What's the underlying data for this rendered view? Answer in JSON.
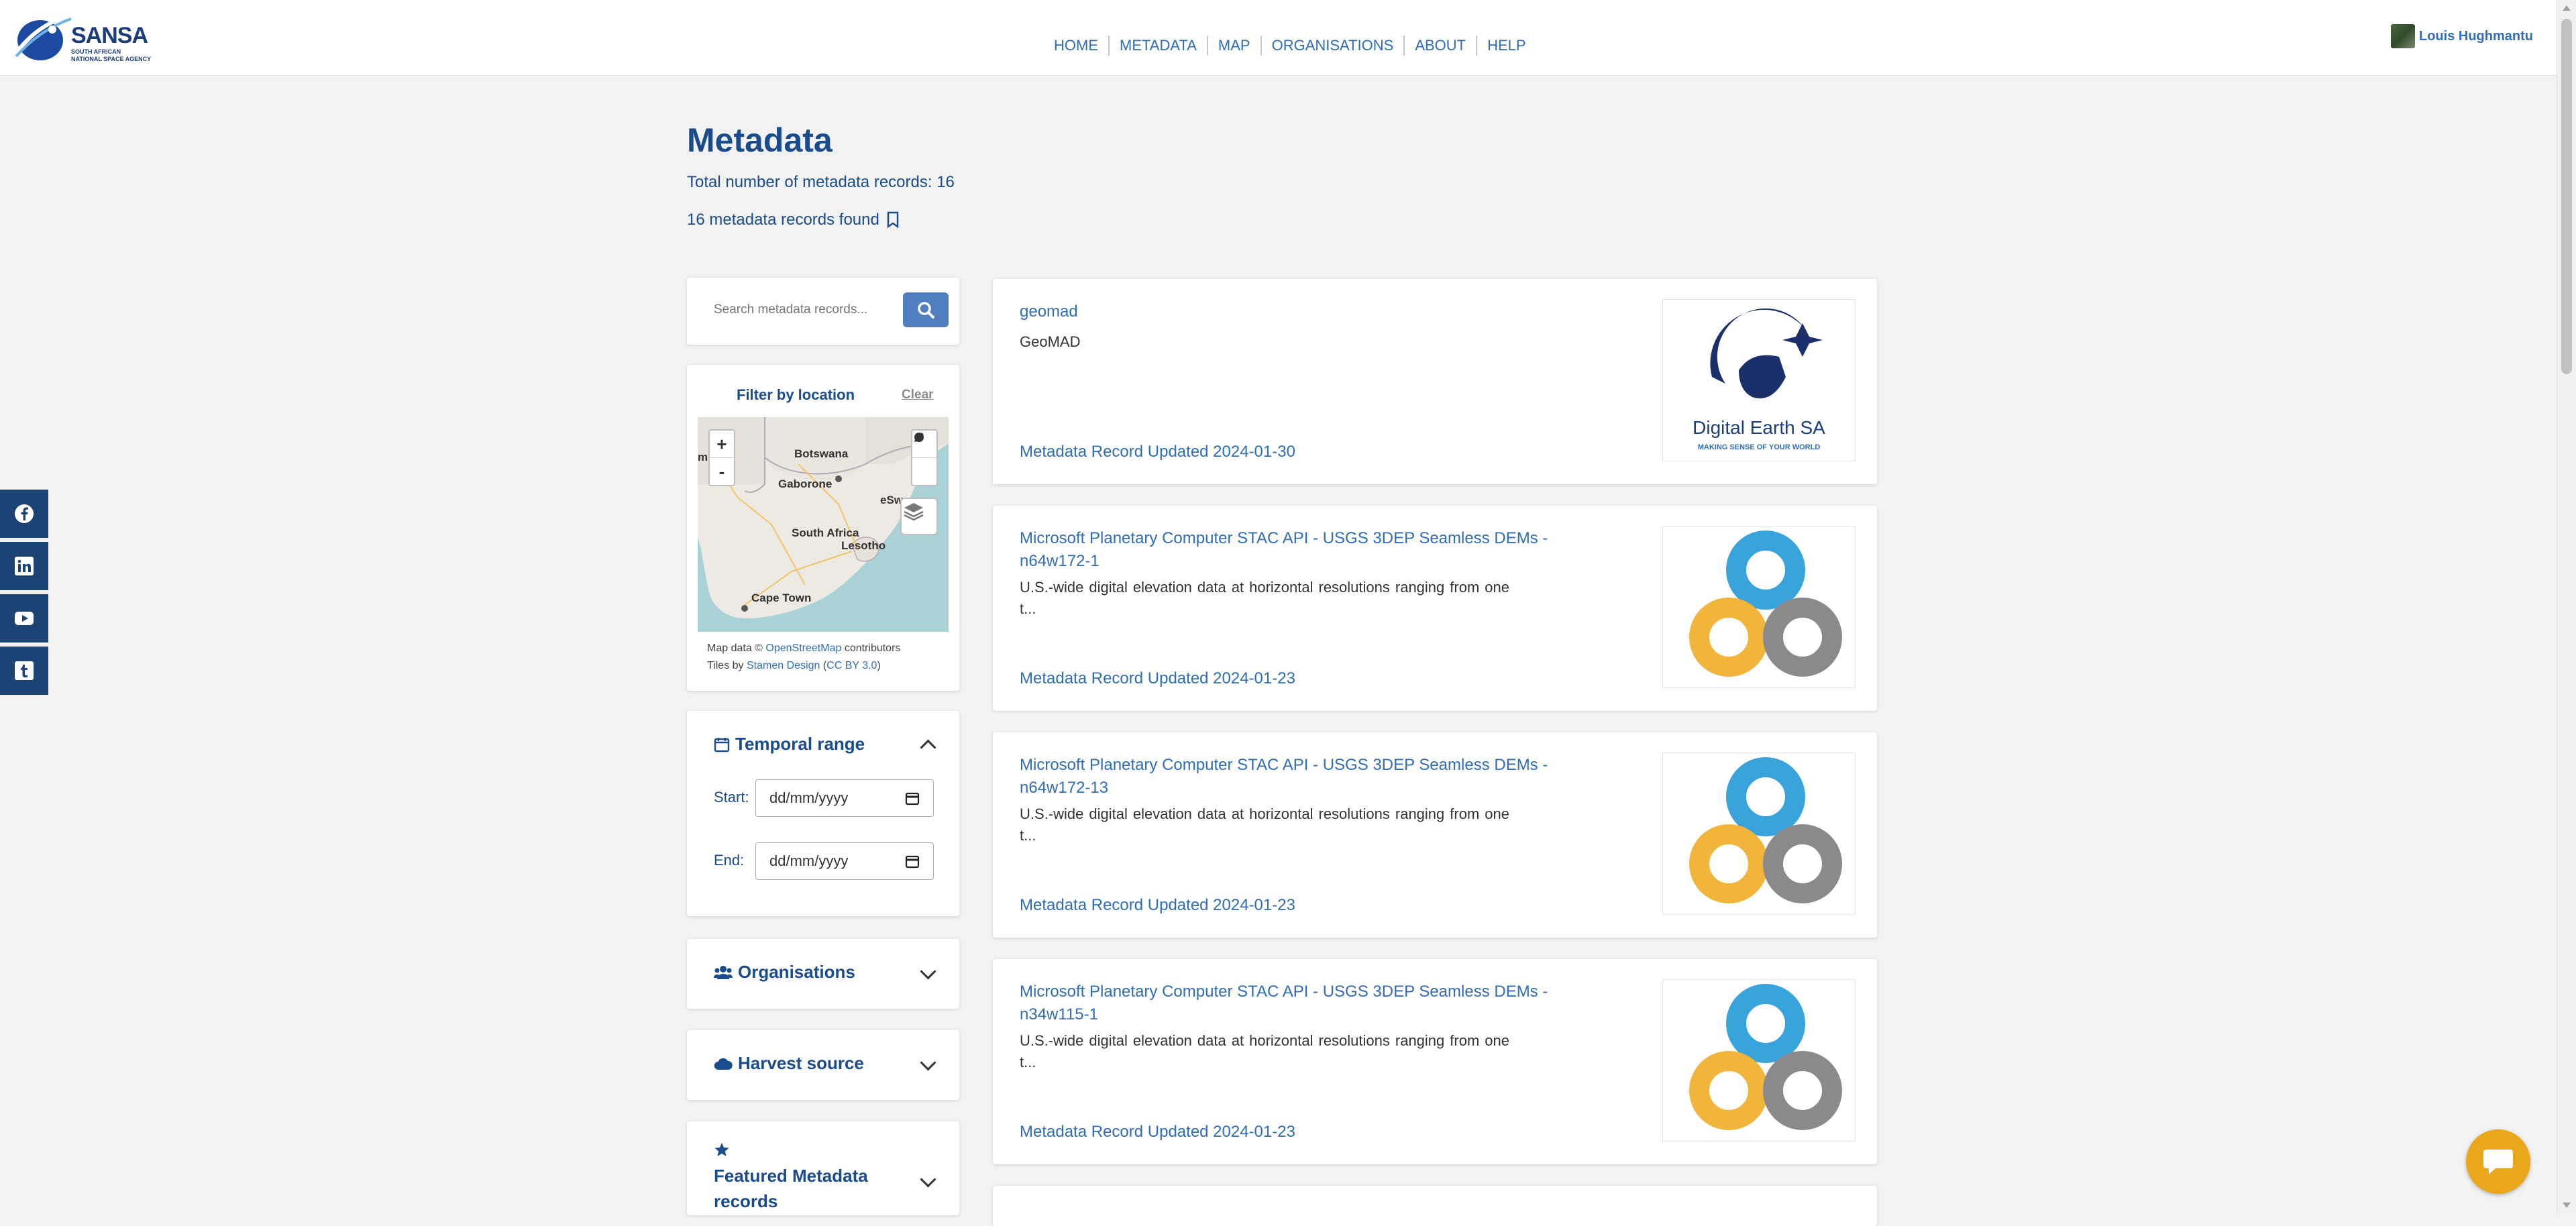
{
  "header": {
    "logo_text": "SANSA",
    "logo_sub": "SOUTH AFRICAN NATIONAL SPACE AGENCY",
    "nav": [
      "HOME",
      "METADATA",
      "MAP",
      "ORGANISATIONS",
      "ABOUT",
      "HELP"
    ],
    "user_name": "Louis Hughmantu"
  },
  "page": {
    "title": "Metadata",
    "total_records": "Total number of metadata records: 16",
    "found": "16 metadata records found"
  },
  "search": {
    "placeholder": "Search metadata records..."
  },
  "location_filter": {
    "title": "Filter by location",
    "clear": "Clear",
    "map_labels": [
      "mibia",
      "Botswana",
      "Gaborone",
      "South Africa",
      "Lesotho",
      "eSw",
      "Cape Town"
    ],
    "zoom_in": "+",
    "zoom_out": "-",
    "attribution_prefix": "Map data ©",
    "attribution_osm": "OpenStreetMap",
    "attribution_contrib": "contributors",
    "tiles_prefix": "Tiles by",
    "tiles_stamen": "Stamen Design",
    "tiles_license": "CC BY 3.0"
  },
  "temporal": {
    "title": "Temporal range",
    "start_label": "Start:",
    "end_label": "End:",
    "date_placeholder": "dd/mm/yyyy"
  },
  "filters": {
    "organisations": "Organisations",
    "harvest_source": "Harvest source",
    "featured": "Featured Metadata records"
  },
  "records": [
    {
      "title": "geomad",
      "description": "GeoMAD",
      "updated": "Metadata Record Updated 2024-01-30",
      "thumb": "digital-earth-sa",
      "thumb_text": "Digital Earth SA",
      "thumb_tagline": "MAKING SENSE OF YOUR WORLD"
    },
    {
      "title": "Microsoft Planetary Computer STAC API - USGS 3DEP Seamless DEMs - n64w172-1",
      "description": "U.S.-wide digital elevation data at horizontal resolutions ranging from one t...",
      "updated": "Metadata Record Updated 2024-01-23",
      "thumb": "planetary-computer"
    },
    {
      "title": "Microsoft Planetary Computer STAC API - USGS 3DEP Seamless DEMs - n64w172-13",
      "description": "U.S.-wide digital elevation data at horizontal resolutions ranging from one t...",
      "updated": "Metadata Record Updated 2024-01-23",
      "thumb": "planetary-computer"
    },
    {
      "title": "Microsoft Planetary Computer STAC API - USGS 3DEP Seamless DEMs - n34w115-1",
      "description": "U.S.-wide digital elevation data at horizontal resolutions ranging from one t...",
      "updated": "Metadata Record Updated 2024-01-23",
      "thumb": "planetary-computer"
    }
  ],
  "social": [
    "facebook-icon",
    "linkedin-icon",
    "youtube-icon",
    "tumblr-icon"
  ],
  "colors": {
    "primary": "#1a4c8b",
    "link": "#2f6db5",
    "search_button": "#4f7fbf",
    "social_bg": "#1b4474",
    "chat_bg": "#e9a81c"
  }
}
